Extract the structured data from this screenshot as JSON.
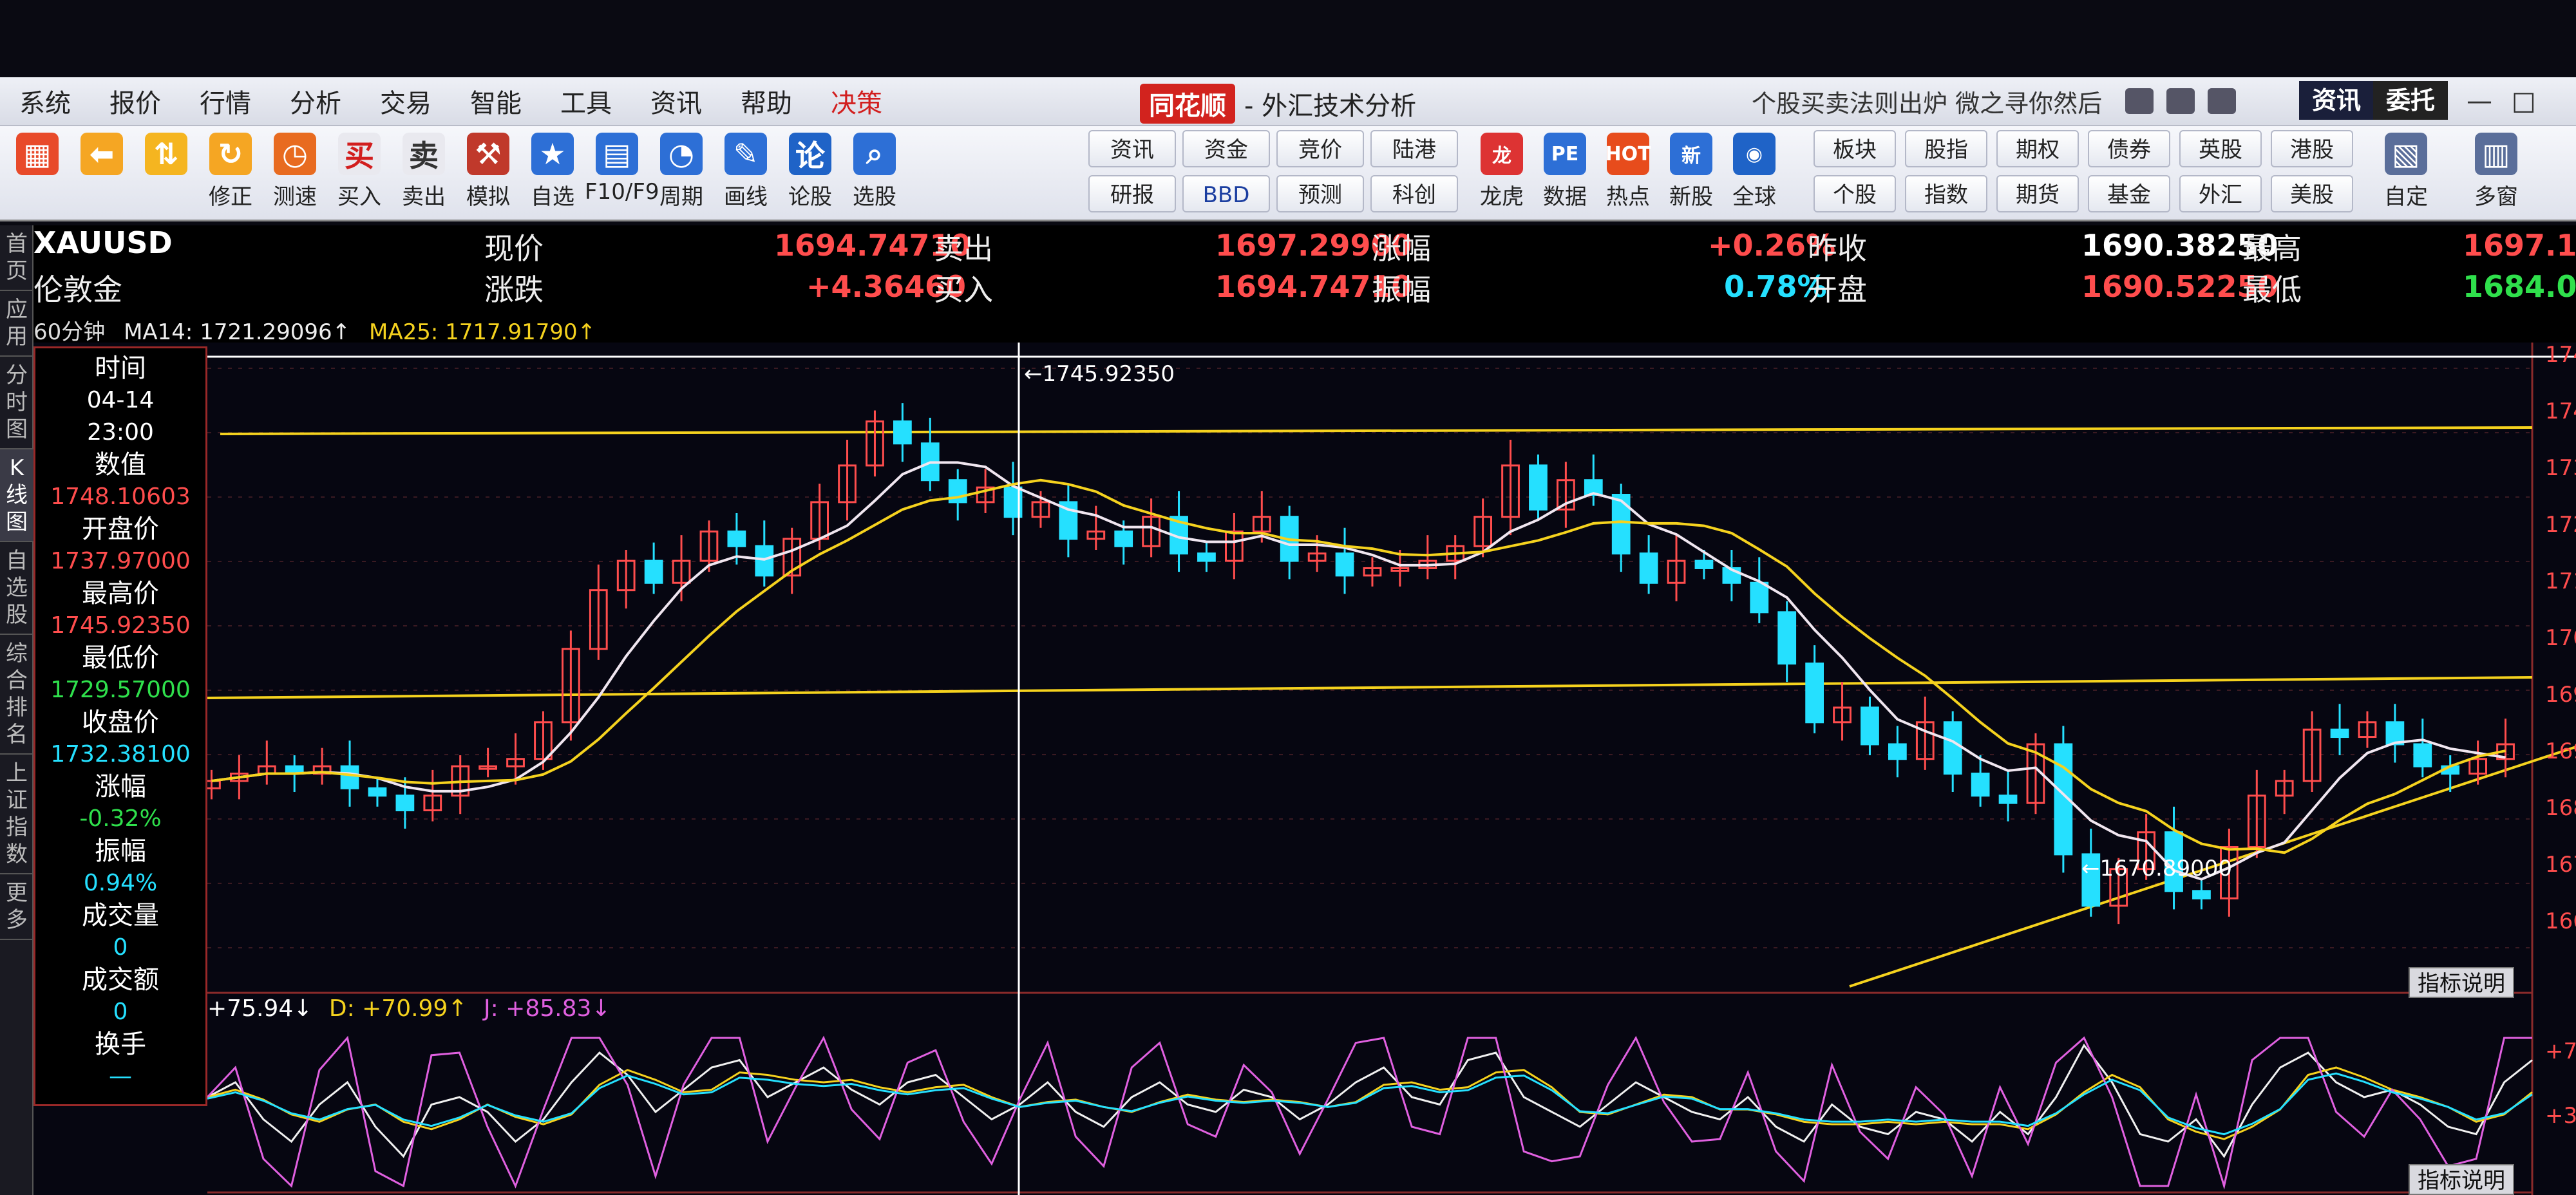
{
  "menu": {
    "items": [
      "系统",
      "报价",
      "行情",
      "分析",
      "交易",
      "智能",
      "工具",
      "资讯",
      "帮助",
      "决策"
    ],
    "app_logo": "同花顺",
    "app_title": "- 外汇技术分析",
    "slogan": "个股买卖法则出炉  微之寻你然后",
    "news_btn": "资讯",
    "entrust_btn": "委托"
  },
  "toolbar": {
    "main": [
      {
        "label": "",
        "icon": "grid-icon"
      },
      {
        "label": "",
        "icon": "back-arrow-icon"
      },
      {
        "label": "",
        "icon": "up-down-arrow-icon"
      },
      {
        "label": "修正",
        "icon": "refresh-icon"
      },
      {
        "label": "测速",
        "icon": "speed-icon"
      },
      {
        "label": "买入",
        "icon": "buy-icon"
      },
      {
        "label": "卖出",
        "icon": "sell-icon"
      },
      {
        "label": "模拟",
        "icon": "gavel-icon"
      },
      {
        "label": "自选",
        "icon": "star-icon"
      },
      {
        "label": "F10/F9",
        "icon": "f10-icon"
      },
      {
        "label": "周期",
        "icon": "clock-icon"
      },
      {
        "label": "画线",
        "icon": "pencil-icon"
      },
      {
        "label": "论股",
        "icon": "discuss-icon"
      },
      {
        "label": "选股",
        "icon": "stock-pick-icon"
      }
    ],
    "grid_buttons": [
      [
        "资讯",
        "资金",
        "竞价",
        "陆港"
      ],
      [
        "研报",
        "BBD",
        "预测",
        "科创"
      ]
    ],
    "icon_buttons": [
      {
        "label": "龙虎",
        "icon": "dragon-icon"
      },
      {
        "label": "数据",
        "icon": "pe-icon"
      },
      {
        "label": "热点",
        "icon": "hot-icon"
      },
      {
        "label": "新股",
        "icon": "new-stock-icon"
      },
      {
        "label": "全球",
        "icon": "globe-icon"
      }
    ],
    "grid_buttons_2": [
      [
        "板块",
        "股指",
        "期权",
        "债券",
        "英股",
        "港股"
      ],
      [
        "个股",
        "指数",
        "期货",
        "基金",
        "外汇",
        "美股"
      ]
    ],
    "right": [
      {
        "label": "自定",
        "icon": "custom-icon"
      },
      {
        "label": "多窗",
        "icon": "multi-window-icon"
      }
    ]
  },
  "side_tabs": [
    "首页",
    "应用",
    "分时图",
    "K线图",
    "自选股",
    "综合排名",
    "上证指数",
    "更多"
  ],
  "quote": {
    "symbol": "XAUUSD",
    "name": "伦敦金",
    "now_label": "现价",
    "now_value": "1694.74710",
    "sell_label": "卖出",
    "sell_value": "1697.29900",
    "change_pct_label": "涨幅",
    "change_pct_value": "+0.26%",
    "prev_close_label": "昨收",
    "prev_close_value": "1690.38250",
    "high_label": "最高",
    "high_value": "1697.1",
    "change_label": "涨跌",
    "change_value": "+4.36460",
    "buy_label": "买入",
    "buy_value": "1694.74710",
    "amplitude_label": "振幅",
    "amplitude_value": "0.78%",
    "open_label": "开盘",
    "open_value": "1690.52250",
    "low_label": "最低",
    "low_value": "1684.0"
  },
  "ma": {
    "period": "60分钟",
    "ma14": "MA14: 1721.29096↑",
    "ma25": "MA25: 1717.91790↑"
  },
  "info_panel": {
    "time_label": "时间",
    "date": "04-14",
    "time": "23:00",
    "value_label": "数值",
    "value": "1748.10603",
    "open_label": "开盘价",
    "open": "1737.97000",
    "high_label": "最高价",
    "high": "1745.92350",
    "low_label": "最低价",
    "low": "1729.57000",
    "close_label": "收盘价",
    "close": "1732.38100",
    "change_label": "涨幅",
    "change": "-0.32%",
    "amp_label": "振幅",
    "amp": "0.94%",
    "vol_label": "成交量",
    "vol": "0",
    "amount_label": "成交额",
    "amount": "0",
    "turnover_label": "换手",
    "turnover": "—"
  },
  "annotations": {
    "high_marker": "←1745.92350",
    "low_marker": "←1670.89000"
  },
  "kdj": {
    "k": "+75.94↓",
    "d": "D: +70.99↑",
    "j": "J: +85.83↓"
  },
  "indicator_btn": "指标说明",
  "price_axis": [
    "174",
    "174",
    "173",
    "172",
    "171",
    "170",
    "169",
    "169",
    "168",
    "167",
    "166"
  ],
  "kdj_axis": [
    "+7",
    "+3"
  ],
  "colors": {
    "up": "#ff4d4d",
    "down": "#25e0ff",
    "ma_white": "#f0e6f0",
    "ma_yellow": "#f5d21e",
    "hline": "#f5d21e",
    "grid": "#8a2a2a"
  },
  "chart_data": {
    "type": "candlestick",
    "series": [
      {
        "name": "MA14",
        "value": 1721.29096
      },
      {
        "name": "MA25",
        "value": 1717.9179
      }
    ],
    "marked_high": 1745.9235,
    "marked_low": 1670.89,
    "close_path": [
      1692,
      1693,
      1694,
      1693,
      1694,
      1691,
      1690,
      1688,
      1690,
      1694,
      1694,
      1695,
      1700,
      1710,
      1718,
      1722,
      1719,
      1722,
      1726,
      1724,
      1720,
      1725,
      1730,
      1735,
      1741,
      1738,
      1733,
      1730,
      1732,
      1728,
      1730,
      1725,
      1726,
      1724,
      1728,
      1723,
      1722,
      1726,
      1728,
      1722,
      1723,
      1720,
      1721,
      1721,
      1722,
      1724,
      1728,
      1735,
      1729,
      1733,
      1731,
      1723,
      1719,
      1722,
      1721,
      1719,
      1715,
      1708,
      1700,
      1702,
      1697,
      1695,
      1700,
      1693,
      1690,
      1689,
      1697,
      1682,
      1675,
      1680,
      1685,
      1677,
      1676,
      1683,
      1690,
      1692,
      1699,
      1698,
      1700,
      1697,
      1694,
      1693,
      1695,
      1697
    ],
    "kdj_k": [
      60,
      70,
      45,
      30,
      55,
      70,
      40,
      20,
      55,
      60,
      50,
      30,
      45,
      70,
      90,
      75,
      50,
      65,
      80,
      85,
      60,
      70,
      80,
      65,
      55,
      70,
      75,
      60,
      45,
      55,
      70,
      50,
      40,
      60,
      70,
      55,
      50,
      65,
      60,
      45,
      55,
      70,
      80,
      60,
      55,
      85,
      90,
      60,
      50,
      40,
      55,
      70,
      60,
      50,
      45,
      60,
      40,
      30,
      55,
      40,
      35,
      50,
      45,
      30,
      50,
      35,
      60,
      95,
      70,
      35,
      30,
      45,
      20,
      55,
      80,
      90,
      70,
      60,
      65,
      55,
      40,
      35,
      70,
      85
    ],
    "ylim": [
      1664,
      1750
    ]
  }
}
